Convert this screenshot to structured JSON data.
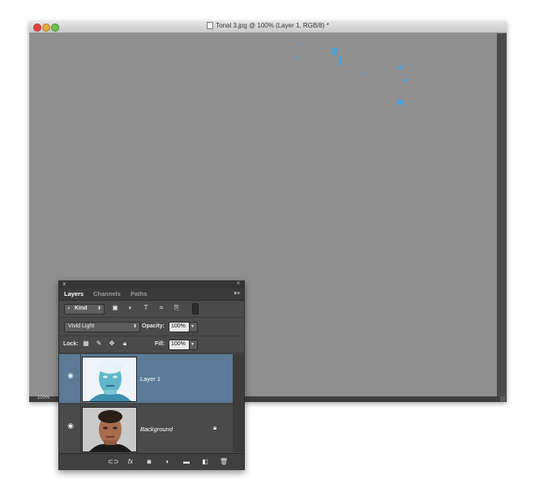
{
  "document": {
    "title": "Tonal 3.jpg @ 100% (Layer 1, RGB/8) *",
    "zoom": "100%"
  },
  "layers_panel": {
    "tabs": [
      "Layers",
      "Channels",
      "Paths"
    ],
    "filter": {
      "kind_label": "Kind",
      "icons": [
        "pixel-filter-icon",
        "adjustment-filter-icon",
        "type-filter-icon",
        "shape-filter-icon",
        "smart-object-filter-icon"
      ]
    },
    "blend_mode": "Vivid Light",
    "opacity_label": "Opacity:",
    "opacity_value": "100%",
    "lock_label": "Lock:",
    "fill_label": "Fill:",
    "fill_value": "100%",
    "layers": [
      {
        "name": "Layer 1",
        "selected": true,
        "visible": true
      },
      {
        "name": "Background",
        "selected": false,
        "visible": true,
        "locked": true
      }
    ],
    "bottom_icons": [
      "link-layers-icon",
      "fx-icon",
      "layer-mask-icon",
      "adjustment-layer-icon",
      "group-folder-icon",
      "new-layer-icon",
      "trash-icon"
    ]
  },
  "colors": {
    "canvas_gray": "#8f8f8f",
    "selected_layer": "#5a7a98",
    "panel_bg": "#4a4a4a"
  }
}
